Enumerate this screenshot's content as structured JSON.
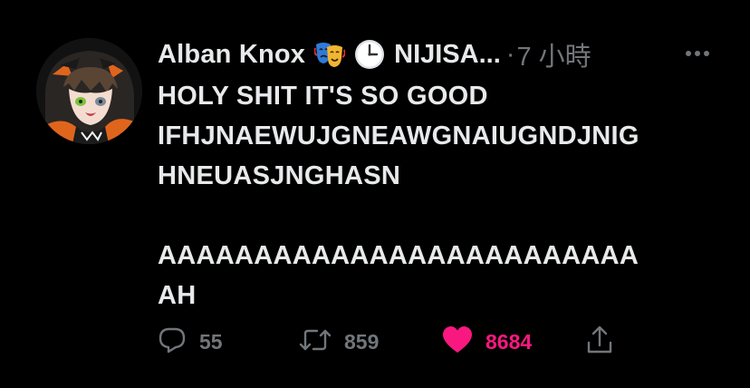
{
  "tweet": {
    "author": {
      "display_name": "Alban Knox",
      "emojis": [
        "performing-arts-emoji",
        "clock-emoji"
      ],
      "handle": "NIJISA...",
      "separator": "·",
      "time": "7 小時"
    },
    "text_lines": [
      "HOLY SHIT IT'S SO GOOD",
      "IFHJNAEWUJGNEAWGNAIUGNDJNIG",
      "HNEUASJNGHASN",
      "",
      "AAAAAAAAAAAAAAAAAAAAAAAAA",
      "AH"
    ],
    "actions": {
      "reply_count": "55",
      "retweet_count": "859",
      "like_count": "8684"
    }
  },
  "colors": {
    "background": "#000000",
    "text": "#e7e9ea",
    "muted": "#71767b",
    "like": "#f91880"
  }
}
